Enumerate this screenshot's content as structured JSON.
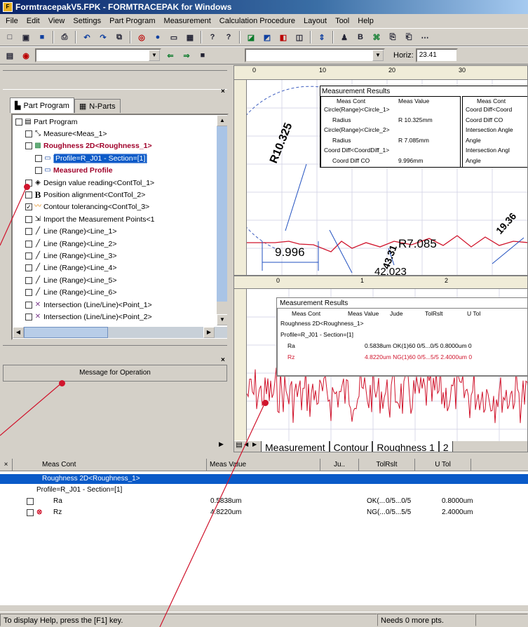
{
  "window": {
    "title": "FormtracepakV5.FPK - FORMTRACEPAK for Windows"
  },
  "menu": [
    "File",
    "Edit",
    "View",
    "Settings",
    "Part Program",
    "Measurement",
    "Calculation Procedure",
    "Layout",
    "Tool",
    "Help"
  ],
  "toolbar2": {
    "horiz_label": "Horiz:",
    "horiz_value": "23.41"
  },
  "left_panel": {
    "tabs": [
      "Part Program",
      "N-Parts"
    ],
    "tree": [
      {
        "label": "Part Program",
        "indent": 0,
        "icon": "document-icon",
        "bold": false
      },
      {
        "label": "Measure<Meas_1>",
        "indent": 1,
        "icon": "measure-icon",
        "bold": false
      },
      {
        "label": "Roughness 2D<Roughness_1>",
        "indent": 1,
        "icon": "roughness-icon",
        "bold": true,
        "color": "#a0002a"
      },
      {
        "label": "Profile=R_J01 - Section=[1]",
        "indent": 2,
        "icon": "profile-icon",
        "bold": false,
        "selected": true
      },
      {
        "label": "Measured Profile",
        "indent": 2,
        "icon": "profile-icon",
        "bold": true,
        "color": "#a0002a"
      },
      {
        "label": "Design value reading<ContTol_1>",
        "indent": 1,
        "icon": "reading-icon",
        "bold": false
      },
      {
        "label": "Position alignment<ContTol_2>",
        "indent": 1,
        "icon": "align-icon",
        "bold": false
      },
      {
        "label": "Contour tolerancing<ContTol_3>",
        "indent": 1,
        "icon": "contour-icon",
        "bold": false,
        "checked": true
      },
      {
        "label": "Import the Measurement Points<1",
        "indent": 1,
        "icon": "import-icon",
        "bold": false
      },
      {
        "label": "Line (Range)<Line_1>",
        "indent": 1,
        "icon": "line-icon",
        "bold": false
      },
      {
        "label": "Line (Range)<Line_2>",
        "indent": 1,
        "icon": "line-icon",
        "bold": false
      },
      {
        "label": "Line (Range)<Line_3>",
        "indent": 1,
        "icon": "line-icon",
        "bold": false
      },
      {
        "label": "Line (Range)<Line_4>",
        "indent": 1,
        "icon": "line-icon",
        "bold": false
      },
      {
        "label": "Line (Range)<Line_5>",
        "indent": 1,
        "icon": "line-icon",
        "bold": false
      },
      {
        "label": "Line (Range)<Line_6>",
        "indent": 1,
        "icon": "line-icon",
        "bold": false
      },
      {
        "label": "Intersection (Line/Line)<Point_1>",
        "indent": 1,
        "icon": "intersection-icon",
        "bold": false
      },
      {
        "label": "Intersection (Line/Line)<Point_2>",
        "indent": 1,
        "icon": "intersection-icon",
        "bold": false
      }
    ],
    "message_title": "Message for Operation"
  },
  "top_graph": {
    "ruler_ticks": [
      "0",
      "10",
      "20",
      "30"
    ],
    "results_title": "Measurement Results",
    "col1": {
      "head1": "Meas Cont",
      "head2": "Meas Value",
      "rows": [
        [
          "Circle(Range)<Circle_1>",
          ""
        ],
        [
          "Radius",
          "R  10.325mm"
        ],
        [
          "Circle(Range)<Circle_2>",
          ""
        ],
        [
          "Radius",
          "R  7.085mm"
        ],
        [
          "Coord Diff<CoordDiff_1>",
          ""
        ],
        [
          "Coord Diff CO",
          "9.996mm"
        ]
      ]
    },
    "col2": {
      "head1": "Meas Cont",
      "rows": [
        "Coord Diff<Coord",
        "Coord Diff CO",
        "Intersection Angle",
        "Angle",
        "Intersection Angl",
        "Angle"
      ]
    },
    "dims": {
      "r1": "R10.325",
      "r2": "R7.085",
      "d1": "9.996",
      "a1": "43.31",
      "a2": "19.36",
      "d2": "42.023"
    }
  },
  "bottom_graph": {
    "ruler_ticks": [
      "0",
      "1",
      "2"
    ],
    "results_title": "Measurement Results",
    "headers": [
      "Meas Cont",
      "Meas Value",
      "Jude",
      "TolRslt",
      "U Tol"
    ],
    "rows": [
      {
        "label": "Roughness 2D<Roughness_1>",
        "value": ""
      },
      {
        "label": "Profile=R_J01 - Section=[1]",
        "value": ""
      },
      {
        "label": "Ra",
        "value": "0.5838um OK(1)60  0/5...0/5 0.8000um 0"
      },
      {
        "label": "Rz",
        "value": "4.8220um NG(1)60  0/5...5/5 2.4000um 0"
      }
    ],
    "tabs": [
      "Measurement",
      "Contour",
      "Roughness 1",
      "2"
    ]
  },
  "bottom_table": {
    "headers": [
      "Meas Cont",
      "Meas Value",
      "Ju..",
      "TolRslt",
      "U Tol"
    ],
    "rows": [
      {
        "label": "Roughness 2D<Roughness_1>",
        "value": "",
        "jud": "",
        "tol": "",
        "utol": "",
        "selected": true
      },
      {
        "label": "Profile=R_J01 - Section=[1]",
        "value": "",
        "jud": "",
        "tol": "",
        "utol": ""
      },
      {
        "label": "Ra",
        "value": "0.5838um",
        "jud": "OK(...",
        "tol": "0/5...0/5",
        "utol": "0.8000um"
      },
      {
        "label": "Rz",
        "value": "4.8220um",
        "jud": "NG(...",
        "tol": "0/5...5/5",
        "utol": "2.4000um"
      }
    ]
  },
  "status": {
    "help": "To display Help, press the [F1] key.",
    "needs": "Needs  0 more pts."
  },
  "colors": {
    "accent": "#0a246a",
    "selection": "#0a5ac8",
    "profile_red": "#d0142c",
    "annotation_dot": "#d0142c"
  }
}
